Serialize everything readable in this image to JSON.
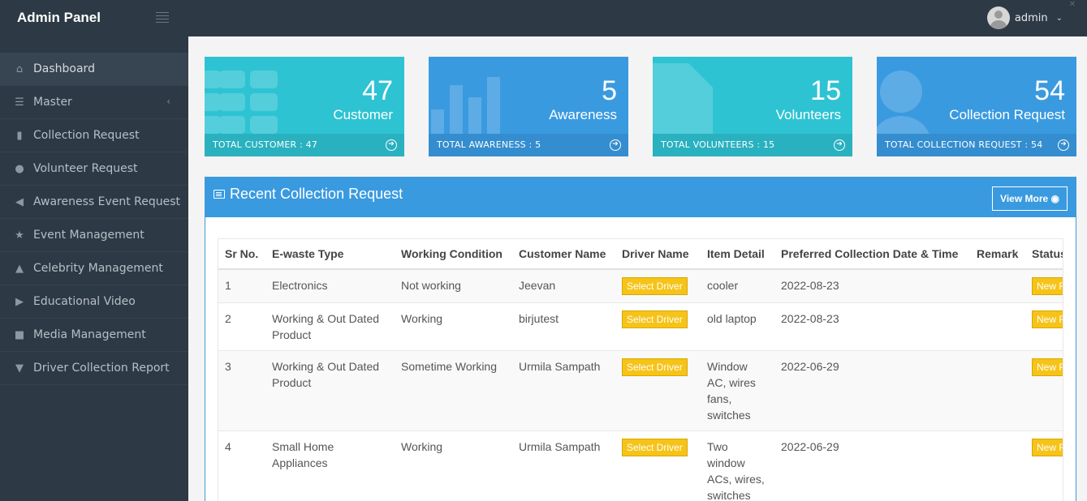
{
  "app": {
    "title": "Admin Panel"
  },
  "user": {
    "name": "admin"
  },
  "sidebar": {
    "items": [
      {
        "label": "Dashboard",
        "icon": "home-icon"
      },
      {
        "label": "Master",
        "icon": "list-icon"
      },
      {
        "label": "Collection Request",
        "icon": "file-icon"
      },
      {
        "label": "Volunteer Request",
        "icon": "users-icon"
      },
      {
        "label": "Awareness Event Request",
        "icon": "volume-icon"
      },
      {
        "label": "Event Management",
        "icon": "star-icon"
      },
      {
        "label": "Celebrity Management",
        "icon": "flask-icon"
      },
      {
        "label": "Educational Video",
        "icon": "play-icon"
      },
      {
        "label": "Media Management",
        "icon": "video-camera-icon"
      },
      {
        "label": "Driver Collection Report",
        "icon": "filter-icon"
      }
    ]
  },
  "stats": [
    {
      "value": "47",
      "label": "Customer",
      "footer": "TOTAL CUSTOMER : 47",
      "color": "#2ec3d3"
    },
    {
      "value": "5",
      "label": "Awareness",
      "footer": "TOTAL AWARENESS : 5",
      "color": "#3a9ae0"
    },
    {
      "value": "15",
      "label": "Volunteers",
      "footer": "TOTAL VOLUNTEERS : 15",
      "color": "#2ec3d3"
    },
    {
      "value": "54",
      "label": "Collection Request",
      "footer": "TOTAL COLLECTION REQUEST : 54",
      "color": "#3a9ae0"
    }
  ],
  "panel": {
    "title": "Recent Collection Request",
    "view_more": "View More"
  },
  "table": {
    "columns": [
      "Sr No.",
      "E-waste Type",
      "Working Condition",
      "Customer Name",
      "Driver Name",
      "Item Detail",
      "Preferred Collection Date & Time",
      "Remark",
      "Status"
    ],
    "rows": [
      {
        "sr": "1",
        "type": "Electronics",
        "condition": "Not working",
        "customer": "Jeevan",
        "driver": "Select Driver",
        "item": "cooler",
        "date": "2022-08-23",
        "remark": "",
        "status": "New Request"
      },
      {
        "sr": "2",
        "type": "Working & Out Dated Product",
        "condition": "Working",
        "customer": "birjutest",
        "driver": "Select Driver",
        "item": "old laptop",
        "date": "2022-08-23",
        "remark": "",
        "status": "New Request"
      },
      {
        "sr": "3",
        "type": "Working & Out Dated Product",
        "condition": "Sometime Working",
        "customer": "Urmila Sampath",
        "driver": "Select Driver",
        "item": "Window AC, wires fans, switches",
        "date": "2022-06-29",
        "remark": "",
        "status": "New Request"
      },
      {
        "sr": "4",
        "type": "Small Home Appliances",
        "condition": "Working",
        "customer": "Urmila Sampath",
        "driver": "Select Driver",
        "item": "Two window ACs, wires, switches",
        "date": "2022-06-29",
        "remark": "",
        "status": "New Request"
      }
    ]
  }
}
